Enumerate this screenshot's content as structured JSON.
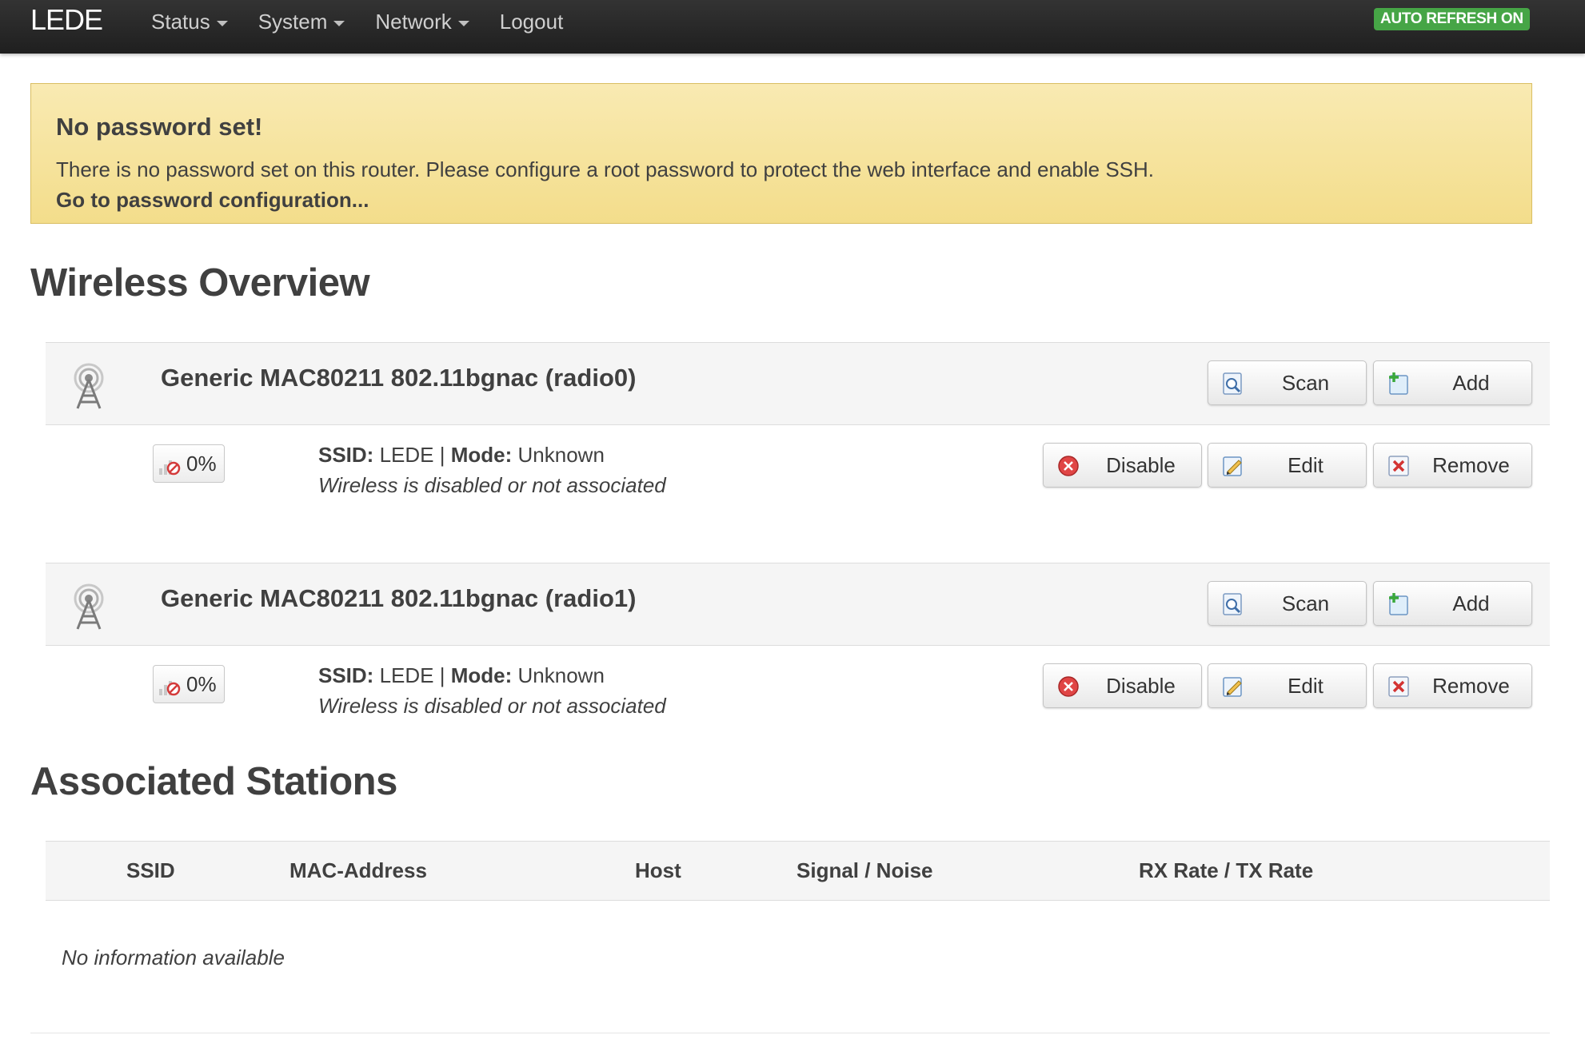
{
  "topbar": {
    "brand": "LEDE",
    "nav": [
      {
        "label": "Status",
        "dropdown": true
      },
      {
        "label": "System",
        "dropdown": true
      },
      {
        "label": "Network",
        "dropdown": true
      },
      {
        "label": "Logout",
        "dropdown": false
      }
    ],
    "auto_refresh": "AUTO REFRESH ON"
  },
  "alert": {
    "title": "No password set!",
    "text": "There is no password set on this router. Please configure a root password to protect the web interface and enable SSH.",
    "link": "Go to password configuration..."
  },
  "wireless": {
    "heading": "Wireless Overview",
    "devices": [
      {
        "name": "Generic MAC80211 802.11bgnac (radio0)",
        "scan": "Scan",
        "add": "Add",
        "network": {
          "signal": "0%",
          "ssid_label": "SSID:",
          "ssid": "LEDE",
          "separator": "|",
          "mode_label": "Mode:",
          "mode": "Unknown",
          "status": "Wireless is disabled or not associated",
          "disable": "Disable",
          "edit": "Edit",
          "remove": "Remove"
        }
      },
      {
        "name": "Generic MAC80211 802.11bgnac (radio1)",
        "scan": "Scan",
        "add": "Add",
        "network": {
          "signal": "0%",
          "ssid_label": "SSID:",
          "ssid": "LEDE",
          "separator": "|",
          "mode_label": "Mode:",
          "mode": "Unknown",
          "status": "Wireless is disabled or not associated",
          "disable": "Disable",
          "edit": "Edit",
          "remove": "Remove"
        }
      }
    ]
  },
  "stations": {
    "heading": "Associated Stations",
    "columns": [
      "SSID",
      "MAC-Address",
      "Host",
      "Signal / Noise",
      "RX Rate / TX Rate"
    ],
    "empty": "No information available"
  },
  "colors": {
    "topbar": "#222222",
    "badge": "#46a546",
    "alert_bg": "#f6e5a3",
    "text": "#404040"
  }
}
